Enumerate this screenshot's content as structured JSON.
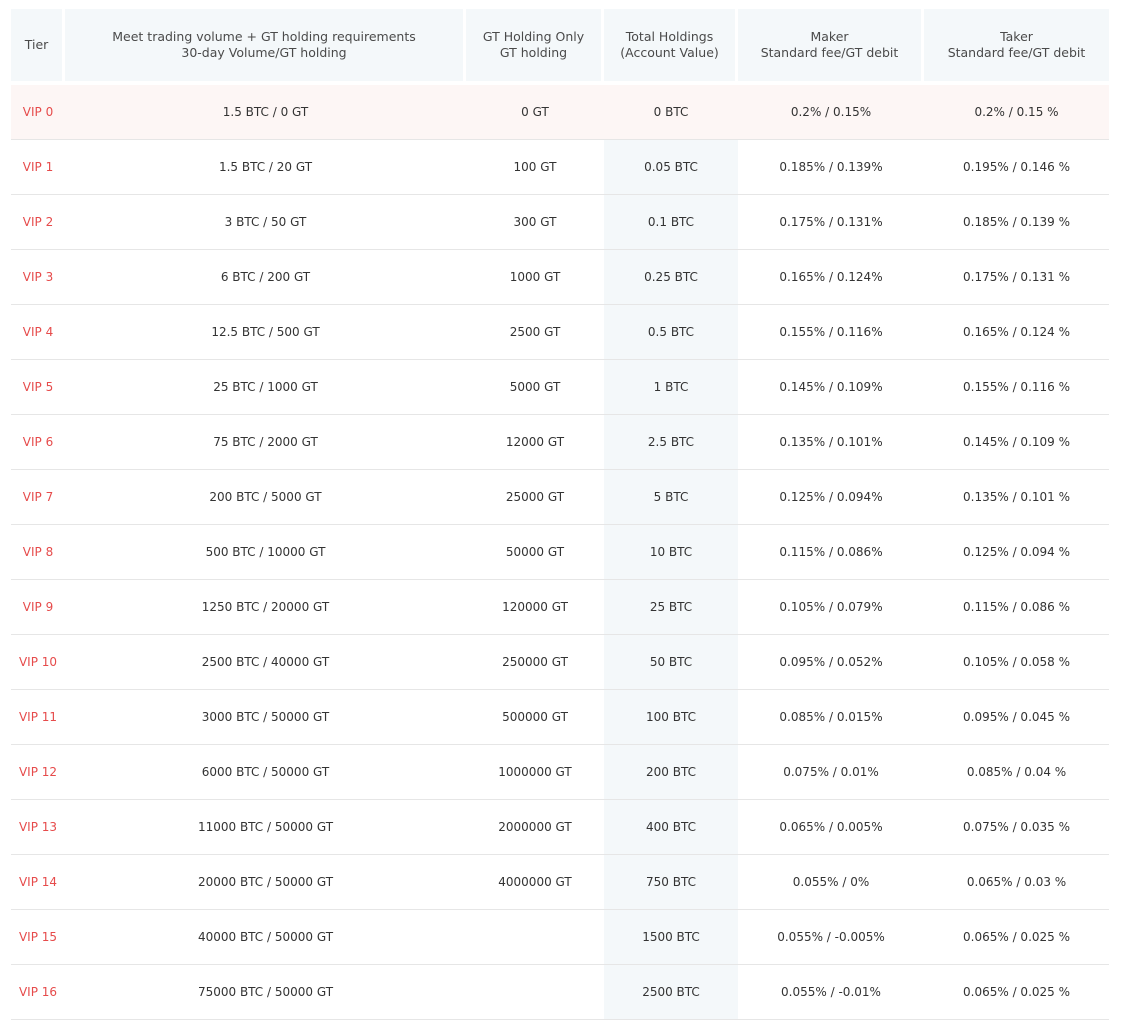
{
  "columns": [
    {
      "lines": [
        "Tier"
      ]
    },
    {
      "lines": [
        "Meet trading volume + GT holding requirements",
        "30-day Volume/GT holding"
      ]
    },
    {
      "lines": [
        "GT Holding Only",
        "GT holding"
      ]
    },
    {
      "lines": [
        "Total Holdings",
        "(Account Value)"
      ]
    },
    {
      "lines": [
        "Maker",
        "Standard fee/GT debit"
      ]
    },
    {
      "lines": [
        "Taker",
        "Standard fee/GT debit"
      ]
    }
  ],
  "rows": [
    {
      "tier": "VIP 0",
      "volume": "1.5 BTC / 0 GT",
      "gt_only": "0 GT",
      "total": "0 BTC",
      "maker": "0.2% / 0.15%",
      "taker": "0.2% / 0.15 %"
    },
    {
      "tier": "VIP 1",
      "volume": "1.5 BTC / 20 GT",
      "gt_only": "100 GT",
      "total": "0.05 BTC",
      "maker": "0.185% / 0.139%",
      "taker": "0.195% / 0.146 %"
    },
    {
      "tier": "VIP 2",
      "volume": "3 BTC / 50 GT",
      "gt_only": "300 GT",
      "total": "0.1 BTC",
      "maker": "0.175% / 0.131%",
      "taker": "0.185% / 0.139 %"
    },
    {
      "tier": "VIP 3",
      "volume": "6 BTC / 200 GT",
      "gt_only": "1000 GT",
      "total": "0.25 BTC",
      "maker": "0.165% / 0.124%",
      "taker": "0.175% / 0.131 %"
    },
    {
      "tier": "VIP 4",
      "volume": "12.5 BTC / 500 GT",
      "gt_only": "2500 GT",
      "total": "0.5 BTC",
      "maker": "0.155% / 0.116%",
      "taker": "0.165% / 0.124 %"
    },
    {
      "tier": "VIP 5",
      "volume": "25 BTC / 1000 GT",
      "gt_only": "5000 GT",
      "total": "1 BTC",
      "maker": "0.145% / 0.109%",
      "taker": "0.155% / 0.116 %"
    },
    {
      "tier": "VIP 6",
      "volume": "75 BTC / 2000 GT",
      "gt_only": "12000 GT",
      "total": "2.5 BTC",
      "maker": "0.135% / 0.101%",
      "taker": "0.145% / 0.109 %"
    },
    {
      "tier": "VIP 7",
      "volume": "200 BTC / 5000 GT",
      "gt_only": "25000 GT",
      "total": "5 BTC",
      "maker": "0.125% / 0.094%",
      "taker": "0.135% / 0.101 %"
    },
    {
      "tier": "VIP 8",
      "volume": "500 BTC / 10000 GT",
      "gt_only": "50000 GT",
      "total": "10 BTC",
      "maker": "0.115% / 0.086%",
      "taker": "0.125% / 0.094 %"
    },
    {
      "tier": "VIP 9",
      "volume": "1250 BTC / 20000 GT",
      "gt_only": "120000 GT",
      "total": "25 BTC",
      "maker": "0.105% / 0.079%",
      "taker": "0.115% / 0.086 %"
    },
    {
      "tier": "VIP 10",
      "volume": "2500 BTC / 40000 GT",
      "gt_only": "250000 GT",
      "total": "50 BTC",
      "maker": "0.095% / 0.052%",
      "taker": "0.105% / 0.058 %"
    },
    {
      "tier": "VIP 11",
      "volume": "3000 BTC / 50000 GT",
      "gt_only": "500000 GT",
      "total": "100 BTC",
      "maker": "0.085% / 0.015%",
      "taker": "0.095% / 0.045 %"
    },
    {
      "tier": "VIP 12",
      "volume": "6000 BTC / 50000 GT",
      "gt_only": "1000000 GT",
      "total": "200 BTC",
      "maker": "0.075% / 0.01%",
      "taker": "0.085% / 0.04 %"
    },
    {
      "tier": "VIP 13",
      "volume": "11000 BTC / 50000 GT",
      "gt_only": "2000000 GT",
      "total": "400 BTC",
      "maker": "0.065% / 0.005%",
      "taker": "0.075% / 0.035 %"
    },
    {
      "tier": "VIP 14",
      "volume": "20000 BTC / 50000 GT",
      "gt_only": "4000000 GT",
      "total": "750 BTC",
      "maker": "0.055% / 0%",
      "taker": "0.065% / 0.03 %"
    },
    {
      "tier": "VIP 15",
      "volume": "40000 BTC / 50000 GT",
      "gt_only": "",
      "total": "1500 BTC",
      "maker": "0.055% / -0.005%",
      "taker": "0.065% / 0.025 %"
    },
    {
      "tier": "VIP 16",
      "volume": "75000 BTC / 50000 GT",
      "gt_only": "",
      "total": "2500 BTC",
      "maker": "0.055% / -0.01%",
      "taker": "0.065% / 0.025 %"
    }
  ],
  "highlight_row_color": "#fdf6f5",
  "tier_text_color": "#e64b4b",
  "header_bg_color": "#f4f8fa"
}
